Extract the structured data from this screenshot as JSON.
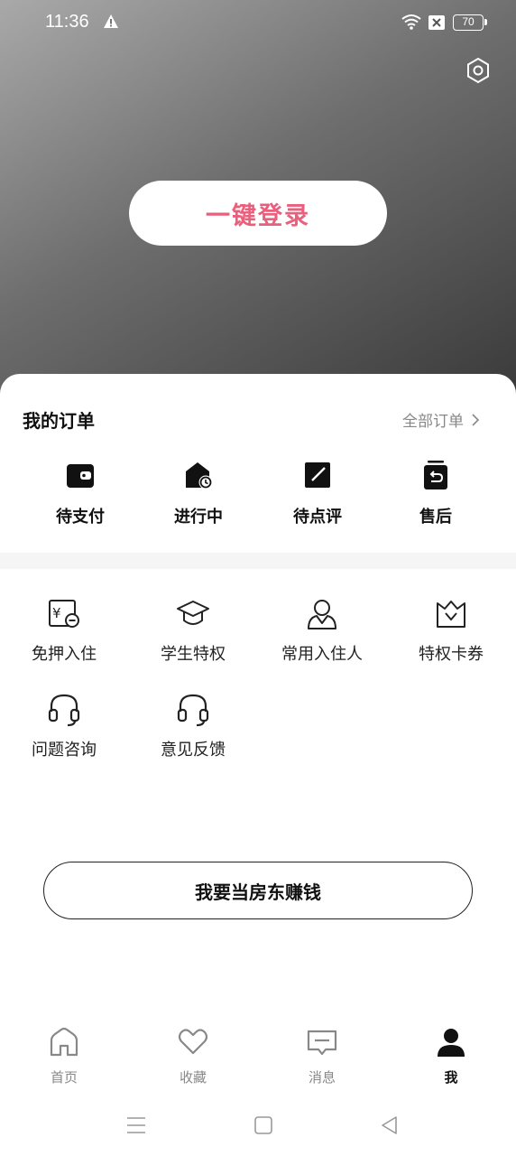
{
  "status_bar": {
    "time": "11:36",
    "battery": "70",
    "icons": [
      "warning-icon",
      "wifi-icon",
      "sim-disabled-icon",
      "battery-icon"
    ]
  },
  "header": {
    "settings_icon": "hexagon-settings-icon",
    "login_label": "一键登录",
    "login_color": "#e8607c"
  },
  "orders": {
    "title": "我的订单",
    "all_label": "全部订单",
    "items": [
      {
        "label": "待支付",
        "icon": "wallet-icon"
      },
      {
        "label": "进行中",
        "icon": "house-clock-icon"
      },
      {
        "label": "待点评",
        "icon": "edit-square-icon"
      },
      {
        "label": "售后",
        "icon": "return-bag-icon"
      }
    ]
  },
  "services": {
    "items": [
      {
        "label": "免押入住",
        "icon": "deposit-free-icon"
      },
      {
        "label": "学生特权",
        "icon": "graduation-cap-icon"
      },
      {
        "label": "常用入住人",
        "icon": "person-icon"
      },
      {
        "label": "特权卡券",
        "icon": "crown-voucher-icon"
      },
      {
        "label": "问题咨询",
        "icon": "headset-icon"
      },
      {
        "label": "意见反馈",
        "icon": "headset-icon"
      }
    ]
  },
  "landlord_button": "我要当房东赚钱",
  "tabbar": {
    "items": [
      {
        "label": "首页",
        "icon": "home-icon"
      },
      {
        "label": "收藏",
        "icon": "heart-icon"
      },
      {
        "label": "消息",
        "icon": "message-icon"
      },
      {
        "label": "我",
        "icon": "user-icon",
        "active": true
      }
    ]
  },
  "system_nav": [
    "menu-icon",
    "home-square-icon",
    "back-triangle-icon"
  ]
}
